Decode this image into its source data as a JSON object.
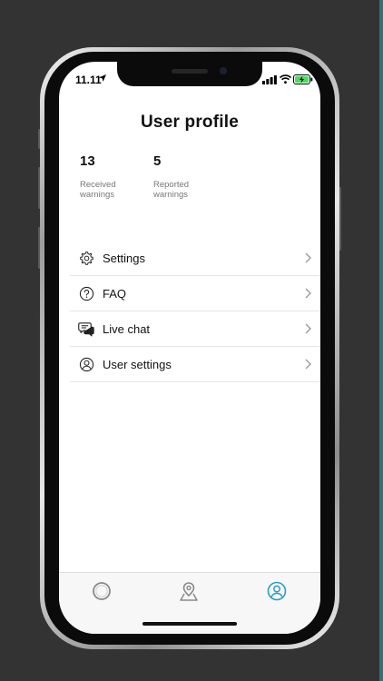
{
  "status_bar": {
    "time": "11.11"
  },
  "page": {
    "title": "User profile"
  },
  "stats": [
    {
      "value": "13",
      "label_line1": "Received",
      "label_line2": "warnings"
    },
    {
      "value": "5",
      "label_line1": "Reported",
      "label_line2": "warnings"
    }
  ],
  "menu": [
    {
      "label": "Settings",
      "icon": "gear-icon"
    },
    {
      "label": "FAQ",
      "icon": "question-circle-icon"
    },
    {
      "label": "Live chat",
      "icon": "chat-bubbles-icon"
    },
    {
      "label": "User settings",
      "icon": "user-circle-icon"
    }
  ],
  "tabs": [
    {
      "icon": "circle-icon",
      "active": false
    },
    {
      "icon": "map-pin-icon",
      "active": false
    },
    {
      "icon": "profile-icon",
      "active": true
    }
  ],
  "colors": {
    "accent": "#2a9ec4",
    "tab_inactive": "#8a8a8a",
    "background": "#333333"
  }
}
